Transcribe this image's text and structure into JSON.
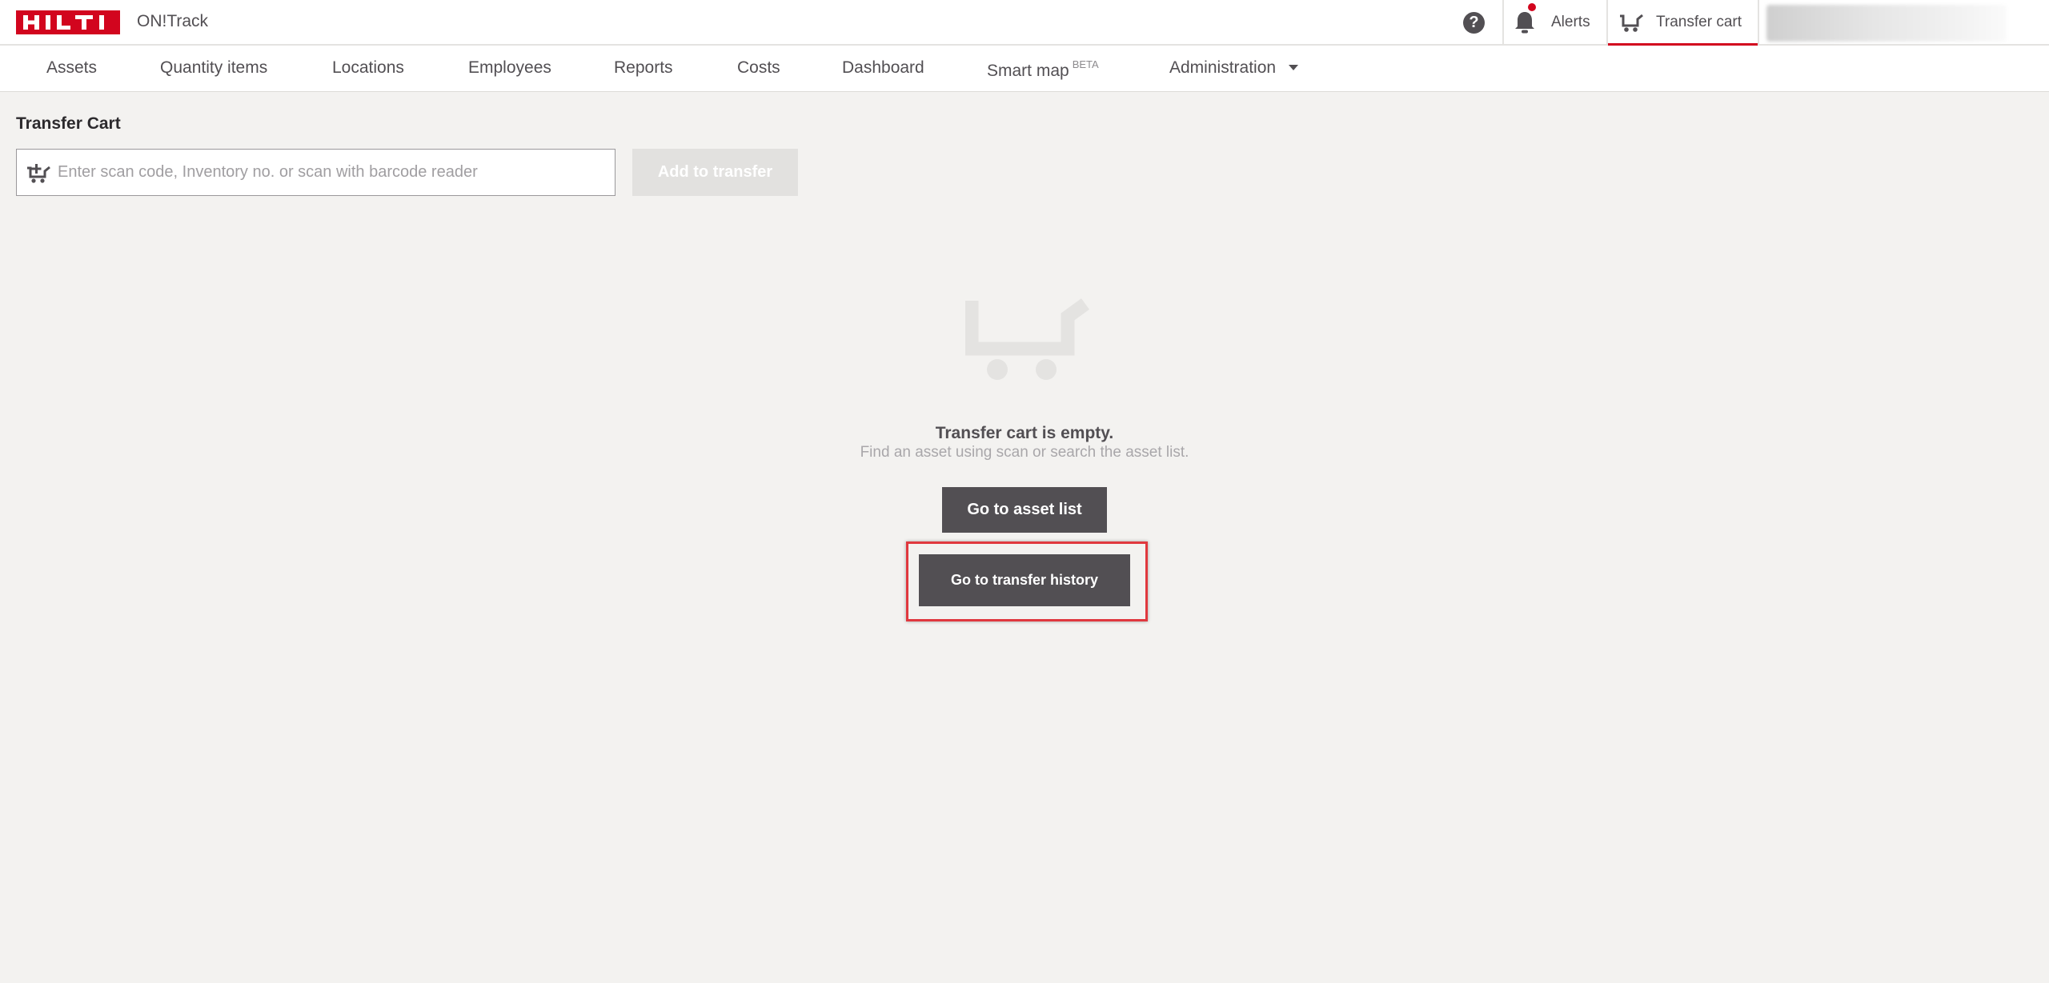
{
  "header": {
    "logo_text": "HILTI",
    "app_name": "ON!Track",
    "help_glyph": "?",
    "alerts_label": "Alerts",
    "transfer_cart_label": "Transfer cart",
    "brand_color": "#d2051e"
  },
  "nav": {
    "items": [
      {
        "label": "Assets"
      },
      {
        "label": "Quantity items"
      },
      {
        "label": "Locations"
      },
      {
        "label": "Employees"
      },
      {
        "label": "Reports"
      },
      {
        "label": "Costs"
      },
      {
        "label": "Dashboard"
      },
      {
        "label": "Smart map",
        "badge": "BETA"
      },
      {
        "label": "Administration"
      }
    ]
  },
  "page": {
    "title": "Transfer Cart",
    "scan_placeholder": "Enter scan code, Inventory no. or scan with barcode reader",
    "scan_value": "",
    "add_button": "Add to transfer",
    "empty_title": "Transfer cart is empty.",
    "empty_subtitle": "Find an asset using scan or search the asset list.",
    "asset_list_button": "Go to asset list",
    "transfer_history_button": "Go to transfer history"
  },
  "icons": [
    "hilti-logo",
    "help-icon",
    "bell-icon",
    "cart-icon",
    "cart-scan-icon",
    "empty-cart-icon",
    "chevron-down-icon"
  ]
}
